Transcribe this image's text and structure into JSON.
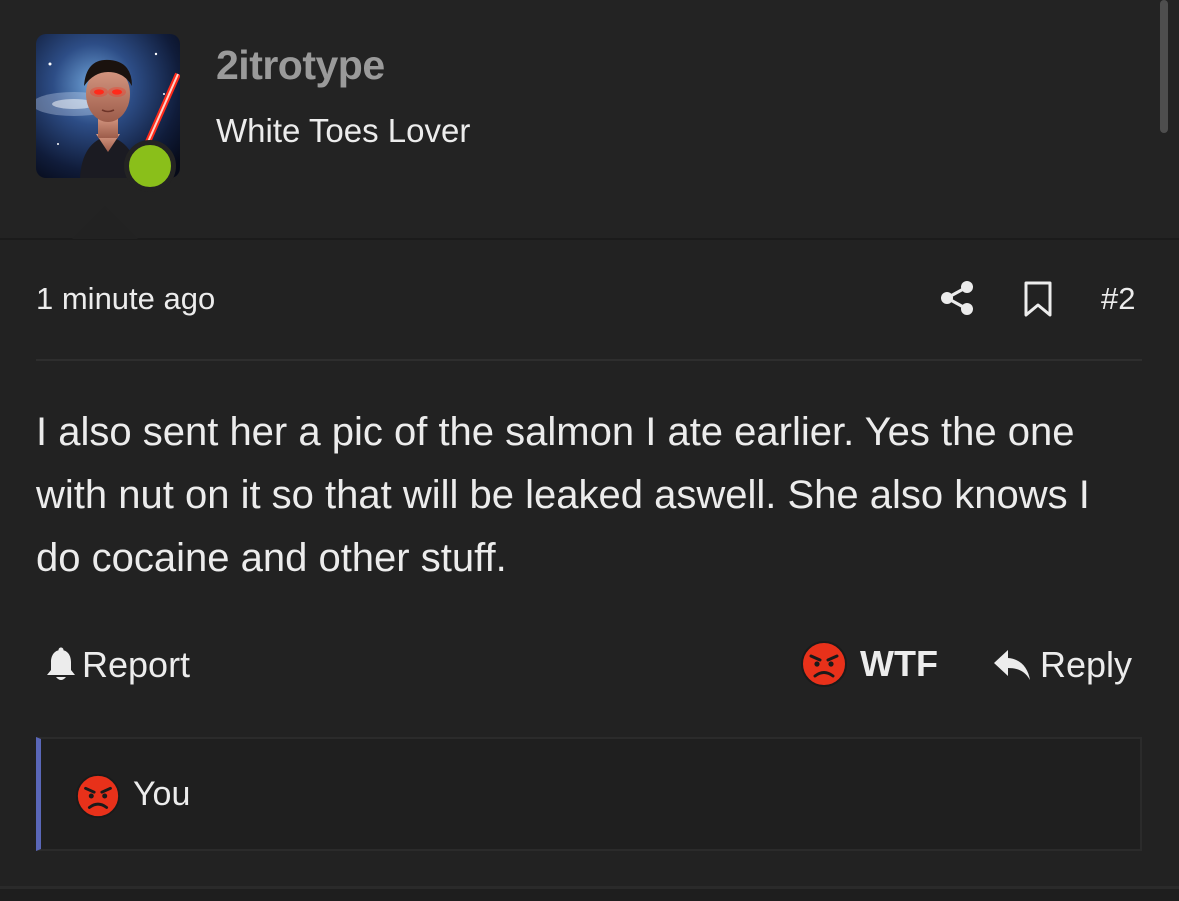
{
  "post": {
    "author": {
      "username": "2itrotype",
      "title": "White Toes Lover",
      "online_color": "#8abf1a",
      "avatar_icon": "avatar-image"
    },
    "meta": {
      "time": "1 minute ago",
      "post_number": "#2"
    },
    "content": "I also sent her a pic of the salmon I ate earlier. Yes the one with nut on it so that will be leaked aswell. She also knows I do cocaine and other stuff.",
    "actions": {
      "report_label": "Report",
      "reaction_label": "WTF",
      "reply_label": "Reply"
    },
    "reactions": {
      "summary": "You",
      "accent_color": "#5a67b8",
      "reaction_color": "#e8311a"
    }
  }
}
